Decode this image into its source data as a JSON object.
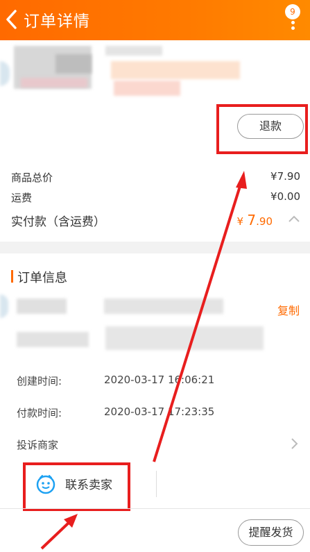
{
  "header": {
    "title": "订单详情",
    "badge_count": "9"
  },
  "product": {
    "refund_label": "退款"
  },
  "price": {
    "goods_total_label": "商品总价",
    "goods_total_value": "¥7.90",
    "shipping_label": "运费",
    "shipping_value": "¥0.00",
    "paid_label": "实付款（含运费）",
    "paid_currency": "¥",
    "paid_int": "7",
    "paid_dec": ".90"
  },
  "order_info": {
    "title": "订单信息",
    "copy_label": "复制",
    "created_label": "创建时间:",
    "created_value": "2020-03-17 16:06:21",
    "paid_time_label": "付款时间:",
    "paid_time_value": "2020-03-17 17:23:35",
    "complain_label": "投诉商家"
  },
  "footer": {
    "contact_label": "联系卖家",
    "remind_label": "提醒发货"
  },
  "colors": {
    "accent": "#ff6a00",
    "annotation_red": "#e81e1e"
  },
  "icons": [
    "back-arrow-icon",
    "more-vertical-icon",
    "chevron-up-icon",
    "chevron-right-icon",
    "seller-chat-icon"
  ]
}
